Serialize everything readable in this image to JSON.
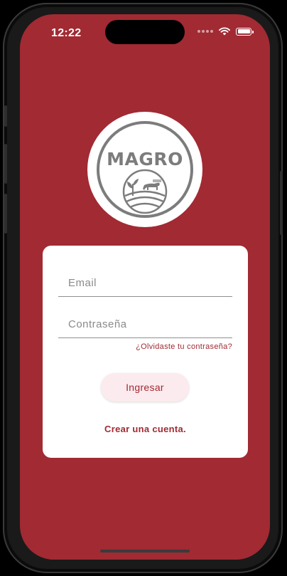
{
  "status_bar": {
    "time": "12:22",
    "signal_icon": "signal-dots-icon",
    "wifi_icon": "wifi-icon",
    "battery_icon": "battery-icon"
  },
  "logo": {
    "text": "MAGRO",
    "icon": "farm-cow-plant-icon"
  },
  "login_form": {
    "email_placeholder": "Email",
    "email_value": "",
    "password_placeholder": "Contraseña",
    "password_value": "",
    "forgot_password_link": "¿Olvidaste tu contraseña?",
    "submit_button": "Ingresar",
    "create_account_link": "Crear una cuenta."
  },
  "colors": {
    "background": "#a12a33",
    "card": "#ffffff",
    "accent": "#a12a33",
    "button_bg": "#fcebee",
    "logo_gray": "#7c7c7c"
  }
}
